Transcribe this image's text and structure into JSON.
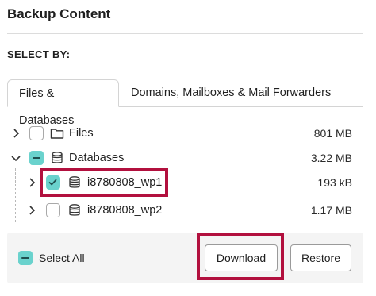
{
  "header": {
    "title": "Backup Content"
  },
  "select_by": {
    "label": "SELECT BY:"
  },
  "tabs": [
    {
      "label": "Files & Databases",
      "active": true
    },
    {
      "label": "Domains, Mailboxes & Mail Forwarders",
      "active": false
    }
  ],
  "tree": [
    {
      "name": "Files",
      "size": "801 MB",
      "icon": "folder-icon",
      "checked": "none",
      "expander": "chevron-right"
    },
    {
      "name": "Databases",
      "size": "3.22 MB",
      "icon": "database-icon",
      "checked": "partial",
      "expander": "chevron-down"
    },
    {
      "name": "i8780808_wp1",
      "size": "193 kB",
      "icon": "database-icon",
      "checked": "checked",
      "expander": "chevron-right"
    },
    {
      "name": "i8780808_wp2",
      "size": "1.17 MB",
      "icon": "database-icon",
      "checked": "none",
      "expander": "chevron-right"
    }
  ],
  "footer": {
    "select_all_label": "Select All",
    "download_label": "Download",
    "restore_label": "Restore"
  },
  "colors": {
    "accent": "#6ad2cd",
    "highlight": "#b2103e",
    "footer_bg": "#f4f4f4"
  }
}
